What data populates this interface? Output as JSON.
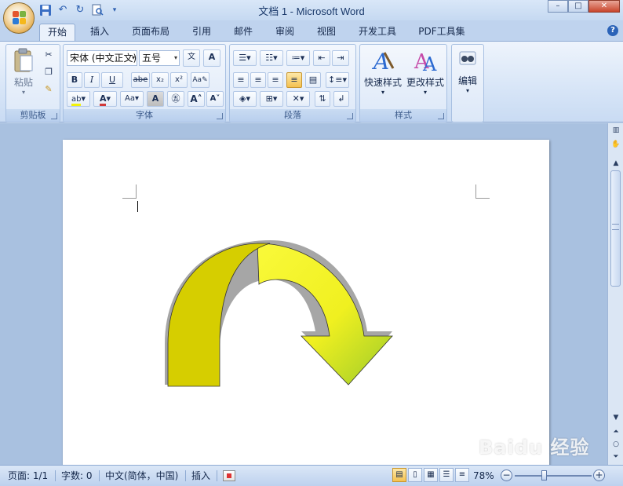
{
  "window": {
    "title": "文档 1 - Microsoft Word",
    "controls": {
      "minimize": "–",
      "maximize": "□",
      "close": "✕"
    }
  },
  "quick_access": [
    "save-icon",
    "undo-icon",
    "redo-icon",
    "print-preview-icon",
    "customize-icon"
  ],
  "tabs": [
    {
      "label": "开始",
      "active": true
    },
    {
      "label": "插入"
    },
    {
      "label": "页面布局"
    },
    {
      "label": "引用"
    },
    {
      "label": "邮件"
    },
    {
      "label": "审阅"
    },
    {
      "label": "视图"
    },
    {
      "label": "开发工具"
    },
    {
      "label": "PDF工具集"
    }
  ],
  "help": "?",
  "ribbon": {
    "clipboard": {
      "label": "剪贴板",
      "paste": "粘贴"
    },
    "font": {
      "label": "字体",
      "font_name": "宋体 (中文正文)",
      "font_size": "五号",
      "buttons": [
        "B",
        "I",
        "U",
        "abe",
        "x₂",
        "x²",
        "A",
        "Aa"
      ]
    },
    "paragraph": {
      "label": "段落"
    },
    "styles": {
      "label": "样式",
      "quick_styles": "快速样式",
      "change_styles": "更改样式"
    },
    "editing": {
      "label": "编辑"
    }
  },
  "status": {
    "page": "页面: 1/1",
    "words": "字数: 0",
    "language": "中文(简体，中国)",
    "mode": "插入",
    "zoom": "78%",
    "zoom_level": 0.78
  },
  "watermark": "Baidu 经验",
  "colors": {
    "arrow_dark": "#d4cc00",
    "arrow_light": "#f7f71e",
    "arrow_tip": "#90c020",
    "shadow": "#a0a0a0"
  }
}
